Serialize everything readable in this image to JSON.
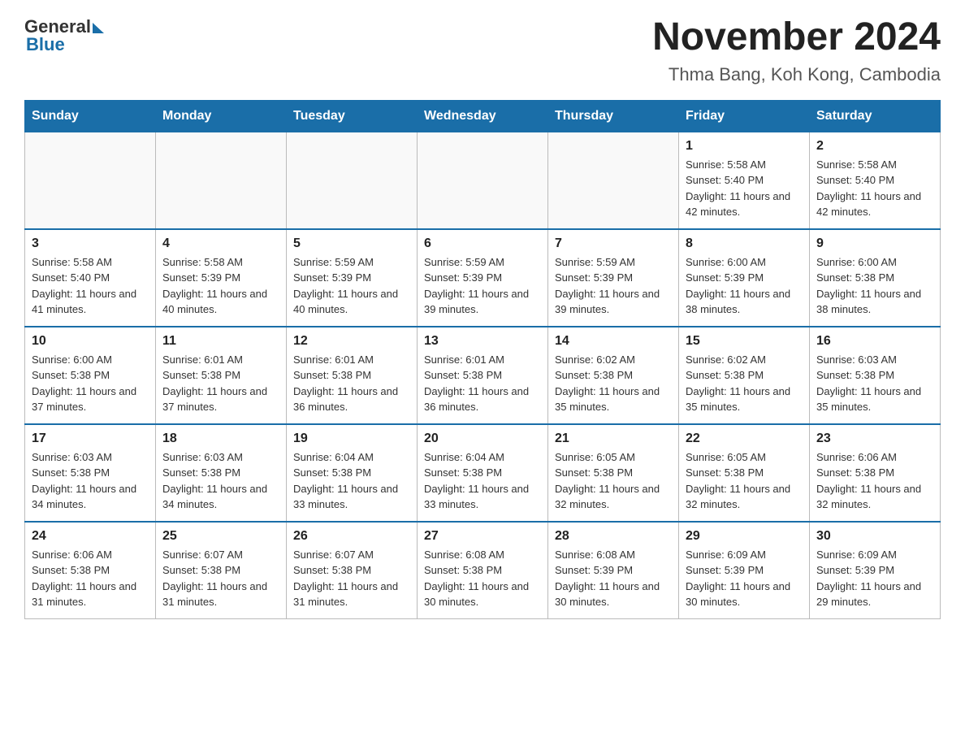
{
  "logo": {
    "general": "General",
    "blue": "Blue"
  },
  "title": "November 2024",
  "subtitle": "Thma Bang, Koh Kong, Cambodia",
  "days_of_week": [
    "Sunday",
    "Monday",
    "Tuesday",
    "Wednesday",
    "Thursday",
    "Friday",
    "Saturday"
  ],
  "weeks": [
    [
      {
        "day": "",
        "sunrise": "",
        "sunset": "",
        "daylight": ""
      },
      {
        "day": "",
        "sunrise": "",
        "sunset": "",
        "daylight": ""
      },
      {
        "day": "",
        "sunrise": "",
        "sunset": "",
        "daylight": ""
      },
      {
        "day": "",
        "sunrise": "",
        "sunset": "",
        "daylight": ""
      },
      {
        "day": "",
        "sunrise": "",
        "sunset": "",
        "daylight": ""
      },
      {
        "day": "1",
        "sunrise": "Sunrise: 5:58 AM",
        "sunset": "Sunset: 5:40 PM",
        "daylight": "Daylight: 11 hours and 42 minutes."
      },
      {
        "day": "2",
        "sunrise": "Sunrise: 5:58 AM",
        "sunset": "Sunset: 5:40 PM",
        "daylight": "Daylight: 11 hours and 42 minutes."
      }
    ],
    [
      {
        "day": "3",
        "sunrise": "Sunrise: 5:58 AM",
        "sunset": "Sunset: 5:40 PM",
        "daylight": "Daylight: 11 hours and 41 minutes."
      },
      {
        "day": "4",
        "sunrise": "Sunrise: 5:58 AM",
        "sunset": "Sunset: 5:39 PM",
        "daylight": "Daylight: 11 hours and 40 minutes."
      },
      {
        "day": "5",
        "sunrise": "Sunrise: 5:59 AM",
        "sunset": "Sunset: 5:39 PM",
        "daylight": "Daylight: 11 hours and 40 minutes."
      },
      {
        "day": "6",
        "sunrise": "Sunrise: 5:59 AM",
        "sunset": "Sunset: 5:39 PM",
        "daylight": "Daylight: 11 hours and 39 minutes."
      },
      {
        "day": "7",
        "sunrise": "Sunrise: 5:59 AM",
        "sunset": "Sunset: 5:39 PM",
        "daylight": "Daylight: 11 hours and 39 minutes."
      },
      {
        "day": "8",
        "sunrise": "Sunrise: 6:00 AM",
        "sunset": "Sunset: 5:39 PM",
        "daylight": "Daylight: 11 hours and 38 minutes."
      },
      {
        "day": "9",
        "sunrise": "Sunrise: 6:00 AM",
        "sunset": "Sunset: 5:38 PM",
        "daylight": "Daylight: 11 hours and 38 minutes."
      }
    ],
    [
      {
        "day": "10",
        "sunrise": "Sunrise: 6:00 AM",
        "sunset": "Sunset: 5:38 PM",
        "daylight": "Daylight: 11 hours and 37 minutes."
      },
      {
        "day": "11",
        "sunrise": "Sunrise: 6:01 AM",
        "sunset": "Sunset: 5:38 PM",
        "daylight": "Daylight: 11 hours and 37 minutes."
      },
      {
        "day": "12",
        "sunrise": "Sunrise: 6:01 AM",
        "sunset": "Sunset: 5:38 PM",
        "daylight": "Daylight: 11 hours and 36 minutes."
      },
      {
        "day": "13",
        "sunrise": "Sunrise: 6:01 AM",
        "sunset": "Sunset: 5:38 PM",
        "daylight": "Daylight: 11 hours and 36 minutes."
      },
      {
        "day": "14",
        "sunrise": "Sunrise: 6:02 AM",
        "sunset": "Sunset: 5:38 PM",
        "daylight": "Daylight: 11 hours and 35 minutes."
      },
      {
        "day": "15",
        "sunrise": "Sunrise: 6:02 AM",
        "sunset": "Sunset: 5:38 PM",
        "daylight": "Daylight: 11 hours and 35 minutes."
      },
      {
        "day": "16",
        "sunrise": "Sunrise: 6:03 AM",
        "sunset": "Sunset: 5:38 PM",
        "daylight": "Daylight: 11 hours and 35 minutes."
      }
    ],
    [
      {
        "day": "17",
        "sunrise": "Sunrise: 6:03 AM",
        "sunset": "Sunset: 5:38 PM",
        "daylight": "Daylight: 11 hours and 34 minutes."
      },
      {
        "day": "18",
        "sunrise": "Sunrise: 6:03 AM",
        "sunset": "Sunset: 5:38 PM",
        "daylight": "Daylight: 11 hours and 34 minutes."
      },
      {
        "day": "19",
        "sunrise": "Sunrise: 6:04 AM",
        "sunset": "Sunset: 5:38 PM",
        "daylight": "Daylight: 11 hours and 33 minutes."
      },
      {
        "day": "20",
        "sunrise": "Sunrise: 6:04 AM",
        "sunset": "Sunset: 5:38 PM",
        "daylight": "Daylight: 11 hours and 33 minutes."
      },
      {
        "day": "21",
        "sunrise": "Sunrise: 6:05 AM",
        "sunset": "Sunset: 5:38 PM",
        "daylight": "Daylight: 11 hours and 32 minutes."
      },
      {
        "day": "22",
        "sunrise": "Sunrise: 6:05 AM",
        "sunset": "Sunset: 5:38 PM",
        "daylight": "Daylight: 11 hours and 32 minutes."
      },
      {
        "day": "23",
        "sunrise": "Sunrise: 6:06 AM",
        "sunset": "Sunset: 5:38 PM",
        "daylight": "Daylight: 11 hours and 32 minutes."
      }
    ],
    [
      {
        "day": "24",
        "sunrise": "Sunrise: 6:06 AM",
        "sunset": "Sunset: 5:38 PM",
        "daylight": "Daylight: 11 hours and 31 minutes."
      },
      {
        "day": "25",
        "sunrise": "Sunrise: 6:07 AM",
        "sunset": "Sunset: 5:38 PM",
        "daylight": "Daylight: 11 hours and 31 minutes."
      },
      {
        "day": "26",
        "sunrise": "Sunrise: 6:07 AM",
        "sunset": "Sunset: 5:38 PM",
        "daylight": "Daylight: 11 hours and 31 minutes."
      },
      {
        "day": "27",
        "sunrise": "Sunrise: 6:08 AM",
        "sunset": "Sunset: 5:38 PM",
        "daylight": "Daylight: 11 hours and 30 minutes."
      },
      {
        "day": "28",
        "sunrise": "Sunrise: 6:08 AM",
        "sunset": "Sunset: 5:39 PM",
        "daylight": "Daylight: 11 hours and 30 minutes."
      },
      {
        "day": "29",
        "sunrise": "Sunrise: 6:09 AM",
        "sunset": "Sunset: 5:39 PM",
        "daylight": "Daylight: 11 hours and 30 minutes."
      },
      {
        "day": "30",
        "sunrise": "Sunrise: 6:09 AM",
        "sunset": "Sunset: 5:39 PM",
        "daylight": "Daylight: 11 hours and 29 minutes."
      }
    ]
  ]
}
